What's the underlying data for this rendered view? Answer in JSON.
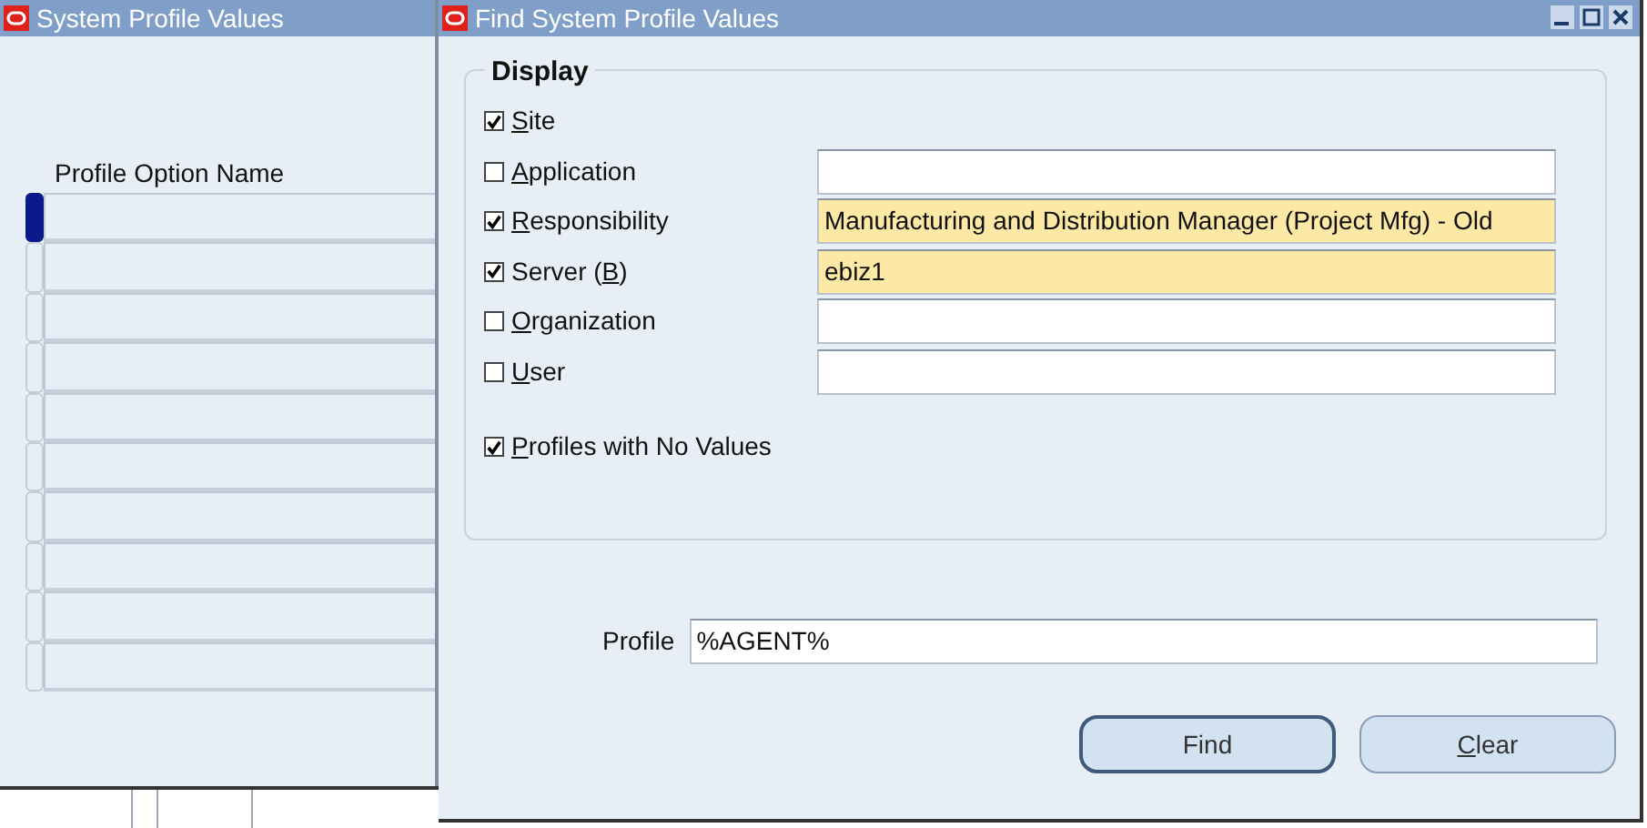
{
  "background_window": {
    "title": "System Profile Values",
    "column_header": "Profile Option Name",
    "rows": [
      {
        "selected": true
      },
      {
        "selected": false
      },
      {
        "selected": false
      },
      {
        "selected": false
      },
      {
        "selected": false
      },
      {
        "selected": false
      },
      {
        "selected": false
      },
      {
        "selected": false
      },
      {
        "selected": false
      },
      {
        "selected": false
      }
    ]
  },
  "dialog": {
    "title": "Find System Profile Values",
    "display_group": {
      "title": "Display",
      "options": [
        {
          "kind": "check",
          "access_key": "S",
          "label_after": "ite",
          "checked": true
        },
        {
          "kind": "field",
          "access_key": "A",
          "label_after": "pplication",
          "checked": false,
          "highlighted": false
        },
        {
          "kind": "field",
          "access_key": "R",
          "label_after": "esponsibility",
          "checked": true,
          "value": "Manufacturing and Distribution Manager (Project Mfg) - Old",
          "highlighted": true
        },
        {
          "kind": "field",
          "label_before": "Server (",
          "access_key": "B",
          "label_after": ")",
          "checked": true,
          "value": "ebiz1",
          "highlighted": true
        },
        {
          "kind": "field",
          "access_key": "O",
          "label_after": "rganization",
          "checked": false,
          "highlighted": false
        },
        {
          "kind": "field",
          "access_key": "U",
          "label_after": "ser",
          "checked": false,
          "highlighted": false
        },
        {
          "kind": "standalone",
          "access_key": "P",
          "label_after": "rofiles with No Values",
          "checked": true
        }
      ]
    },
    "profile": {
      "label": "Profile",
      "value": "%AGENT%"
    },
    "buttons": [
      {
        "label_before": "Find",
        "default": true
      },
      {
        "access_key": "C",
        "label_after": "lear",
        "default": false
      }
    ]
  }
}
